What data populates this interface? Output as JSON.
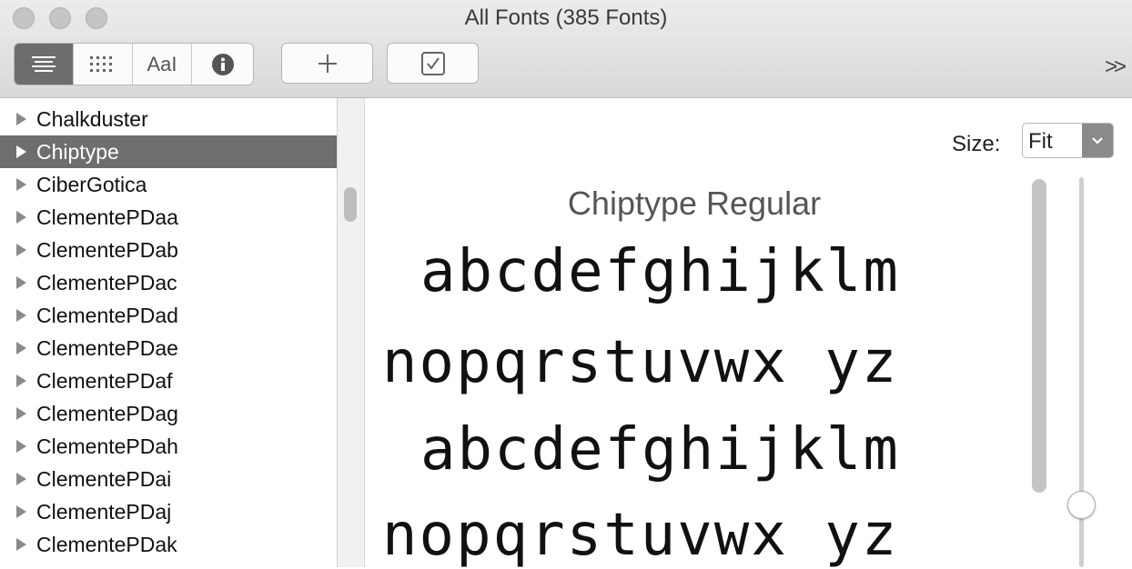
{
  "window": {
    "title": "All Fonts (385 Fonts)"
  },
  "toolbar": {
    "view_modes": [
      {
        "name": "sample-view",
        "icon": "lines-icon",
        "active": true
      },
      {
        "name": "grid-view",
        "icon": "grid-icon",
        "active": false
      },
      {
        "name": "custom-view",
        "icon": "text-cursor-icon",
        "label": "Aa",
        "active": false
      },
      {
        "name": "info-view",
        "icon": "info-icon",
        "active": false
      }
    ],
    "add_icon": "plus-icon",
    "validate_icon": "checkbox-icon",
    "overflow_label": ">>"
  },
  "sidebar": {
    "items": [
      {
        "label": "Chalkduster",
        "selected": false
      },
      {
        "label": "Chiptype",
        "selected": true
      },
      {
        "label": "CiberGotica",
        "selected": false
      },
      {
        "label": "ClementePDaa",
        "selected": false
      },
      {
        "label": "ClementePDab",
        "selected": false
      },
      {
        "label": "ClementePDac",
        "selected": false
      },
      {
        "label": "ClementePDad",
        "selected": false
      },
      {
        "label": "ClementePDae",
        "selected": false
      },
      {
        "label": "ClementePDaf",
        "selected": false
      },
      {
        "label": "ClementePDag",
        "selected": false
      },
      {
        "label": "ClementePDah",
        "selected": false
      },
      {
        "label": "ClementePDai",
        "selected": false
      },
      {
        "label": "ClementePDaj",
        "selected": false
      },
      {
        "label": "ClementePDak",
        "selected": false
      }
    ]
  },
  "preview": {
    "size_label": "Size:",
    "size_value": "Fit",
    "font_name": "Chiptype Regular",
    "lines": [
      "abcdefghijklm",
      "nopqrstuvwx yz",
      "abcdefghijklm",
      "nopqrstuvwx yz"
    ]
  },
  "colors": {
    "selection": "#6e6e6e",
    "toolbar_bg": "#e2e2e2"
  }
}
